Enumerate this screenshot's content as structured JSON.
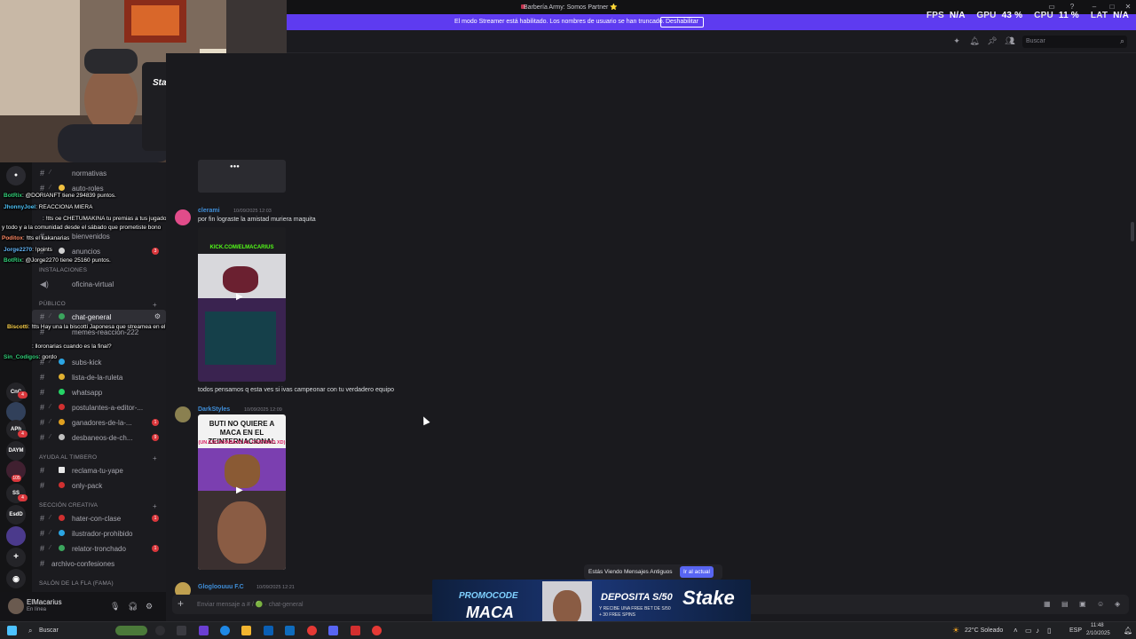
{
  "window": {
    "title": "Barbería Army: Somos Partner ⭐"
  },
  "streamer_banner": {
    "text": "El modo Streamer está habilitado. Los nombres de usuario se han truncado.",
    "button": "Deshabilitar"
  },
  "perf_overlay": {
    "fps_label": "FPS",
    "fps_value": "N/A",
    "gpu_label": "GPU",
    "gpu_value": "43 %",
    "cpu_label": "CPU",
    "cpu_value": "11 %",
    "lat_label": "LAT",
    "lat_value": "N/A"
  },
  "toolbar": {
    "search_placeholder": "Buscar"
  },
  "webcam": {
    "sign": "Stake"
  },
  "server_rail": {
    "items": [
      "EsdD",
      "APh",
      "DAYM",
      "CnC",
      "SS"
    ],
    "badges": [
      "105",
      "4",
      "4",
      "4"
    ]
  },
  "channels": {
    "categories": {
      "instalaciones": "INSTALACIONES",
      "publico": "PÚBLICO",
      "ayuda": "AYUDA AL TIMBERO",
      "creativa": "SECCIÓN CREATIVA",
      "salon": "SALÓN DE LA FLA (FAMA)"
    },
    "list": [
      {
        "label": "normativas"
      },
      {
        "label": "auto-roles"
      },
      {
        "label": "bienvenidos"
      },
      {
        "label": "anuncios",
        "count": "3"
      },
      {
        "label": "oficina-virtual"
      },
      {
        "label": "chat-general"
      },
      {
        "label": "memes-reacción-222"
      },
      {
        "label": "subs-kick"
      },
      {
        "label": "lista-de-la-ruleta"
      },
      {
        "label": "whatsapp"
      },
      {
        "label": "postulantes-a-editor-..."
      },
      {
        "label": "ganadores-de-la-...",
        "count": "1"
      },
      {
        "label": "desbaneos-de-ch...",
        "count": "9"
      },
      {
        "label": "reclama-tu-yape"
      },
      {
        "label": "only-pack"
      },
      {
        "label": "hater-con-clase",
        "count": "1"
      },
      {
        "label": "ilustrador-prohibido"
      },
      {
        "label": "relator-tronchado",
        "count": "1"
      },
      {
        "label": "archivo-confesiones"
      }
    ]
  },
  "stream_chat": [
    {
      "name": "BotRix",
      "text": ": @DORIANFT tiene 294839 puntos."
    },
    {
      "name": "JhonnyJoel",
      "text": ": REACCIONA MIERA"
    },
    {
      "name": "",
      "text": ": !tts oe CHETUMAKINA tu premias a tus jugadores con comida"
    },
    {
      "name": "",
      "text": "y todo y a la comunidad desde el sábado que prometiste bono"
    },
    {
      "name": "Poditox",
      "text": ": !tts el kakanarias"
    },
    {
      "name": "Jorge2270",
      "text": ": !points"
    },
    {
      "name": "BotRix",
      "text": ": @Jorge2270 tiene 25160 puntos."
    },
    {
      "name": "Biscotti",
      "text": ": !tts Hay una la biscotti Japonesa que streamea en el morado"
    },
    {
      "name": "",
      "text": ": lloronarias cuando es la final?"
    },
    {
      "name": "Sin_Codigos",
      "text": ": gordo"
    }
  ],
  "user_panel": {
    "name": "ElMacarius",
    "status": "En línea"
  },
  "messages": [
    {
      "author": "clerami",
      "time": "10/09/2025 12:03",
      "text": "por fin lograste la amistad muriera maquita",
      "media_caption": "KICK.COM/ELMACARIUS"
    },
    {
      "author": "",
      "time": "",
      "text": "todos pensamos q esta ves si ivas campeonar con tu verdadero equipo",
      "media_caption": ""
    },
    {
      "author": "DarkStyles",
      "time": "10/09/2025 12:09",
      "text": "",
      "media_caption": "BUTI NO QUIERE A MACA EN EL ZEINTERNACIONAL",
      "media_sub": "(UN ESCARABAJO AL COSTADO XD)"
    },
    {
      "author": "Glogloouuu F.C",
      "time": "10/09/2025 12:21",
      "text": "",
      "media_caption": ""
    }
  ],
  "jump_bar": {
    "text": "Estás Viendo Mensajes Antiguos",
    "button": "Ir al actual"
  },
  "composer": {
    "placeholder": "Enviar mensaje a # / 🟢 · chat-general"
  },
  "ad": {
    "promo": "PROMOCODE",
    "code": "MACA",
    "deposit": "DEPOSITA S/50",
    "sub": "Y RECIBE UNA FREE BET DE S/50 + 30 FREE SPINS",
    "brand": "Stake"
  },
  "taskbar": {
    "search": "Buscar",
    "weather": "22°C Soleado",
    "lang": "ESP",
    "time": "11:48",
    "date": "2/10/2025"
  },
  "colors": {
    "banner": "#5e3bf0",
    "accent": "#5865f2",
    "alert": "#da373c"
  }
}
